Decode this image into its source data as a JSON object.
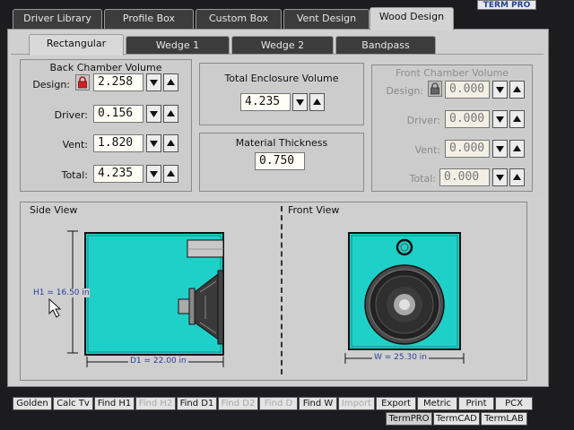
{
  "app": {
    "badge": "TERM PRO"
  },
  "main_tabs": [
    {
      "label": "Driver Library"
    },
    {
      "label": "Profile Box"
    },
    {
      "label": "Custom Box"
    },
    {
      "label": "Vent Design"
    },
    {
      "label": "Wood Design",
      "active": true
    }
  ],
  "sub_tabs": [
    {
      "label": "Rectangular",
      "active": true
    },
    {
      "label": "Wedge 1"
    },
    {
      "label": "Wedge 2"
    },
    {
      "label": "Bandpass"
    }
  ],
  "back_chamber": {
    "title": "Back Chamber Volume",
    "rows": [
      {
        "label": "Design:",
        "value": "2.258",
        "locked": true
      },
      {
        "label": "Driver:",
        "value": "0.156"
      },
      {
        "label": "Vent:",
        "value": "1.820"
      },
      {
        "label": "Total:",
        "value": "4.235"
      }
    ]
  },
  "total_enclosure": {
    "title": "Total Enclosure Volume",
    "value": "4.235"
  },
  "material": {
    "title": "Material Thickness",
    "value": "0.750"
  },
  "front_chamber": {
    "title": "Front Chamber Volume",
    "rows": [
      {
        "label": "Design:",
        "value": "0.000"
      },
      {
        "label": "Driver:",
        "value": "0.000"
      },
      {
        "label": "Vent:",
        "value": "0.000"
      },
      {
        "label": "Total:",
        "value": "0.000"
      }
    ]
  },
  "side_view": {
    "title": "Side View",
    "h_label": "H1 = 16.50 in",
    "d_label": "D1 = 22.00 in"
  },
  "front_view": {
    "title": "Front View",
    "w_label": "W = 25.30 in"
  },
  "colors": {
    "box_fill": "#1fd0c8",
    "tab_dark": "#3c3c3c",
    "panel": "#d0d0d0"
  },
  "toolbar": {
    "row1": [
      {
        "label": "Golden"
      },
      {
        "label": "Calc Tv"
      },
      {
        "label": "Find H1"
      },
      {
        "label": "Find H2",
        "disabled": true
      },
      {
        "label": "Find D1"
      },
      {
        "label": "Find D2",
        "disabled": true
      },
      {
        "label": "Find D",
        "disabled": true
      },
      {
        "label": "Find W"
      },
      {
        "label": "Import",
        "disabled": true
      },
      {
        "label": "Export"
      },
      {
        "label": "Metric"
      },
      {
        "label": "Print"
      },
      {
        "label": "PCX"
      }
    ],
    "row2": [
      {
        "label": "TermPRO",
        "active": true
      },
      {
        "label": "TermCAD"
      },
      {
        "label": "TermLAB"
      }
    ]
  }
}
